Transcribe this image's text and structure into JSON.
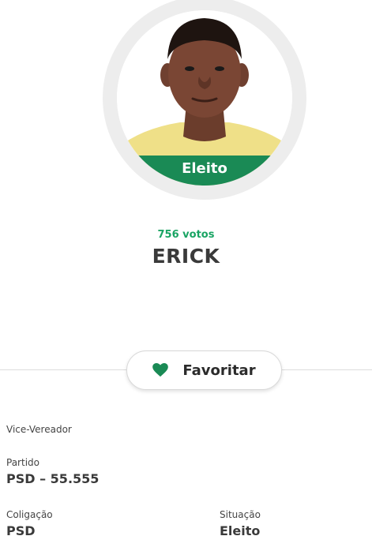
{
  "candidate": {
    "status": "Eleito",
    "votes": "756 votos",
    "name": "ERICK"
  },
  "actions": {
    "favorite_label": "Favoritar",
    "favorite_icon": "heart-icon"
  },
  "details": {
    "role": "Vice-Vereador",
    "party_label": "Partido",
    "party_value": "PSD – 55.555",
    "coalition_label": "Coligação",
    "coalition_value": "PSD",
    "situation_label": "Situação",
    "situation_value": "Eleito"
  },
  "colors": {
    "accent_green": "#1a8a55",
    "votes_green": "#19a463"
  }
}
